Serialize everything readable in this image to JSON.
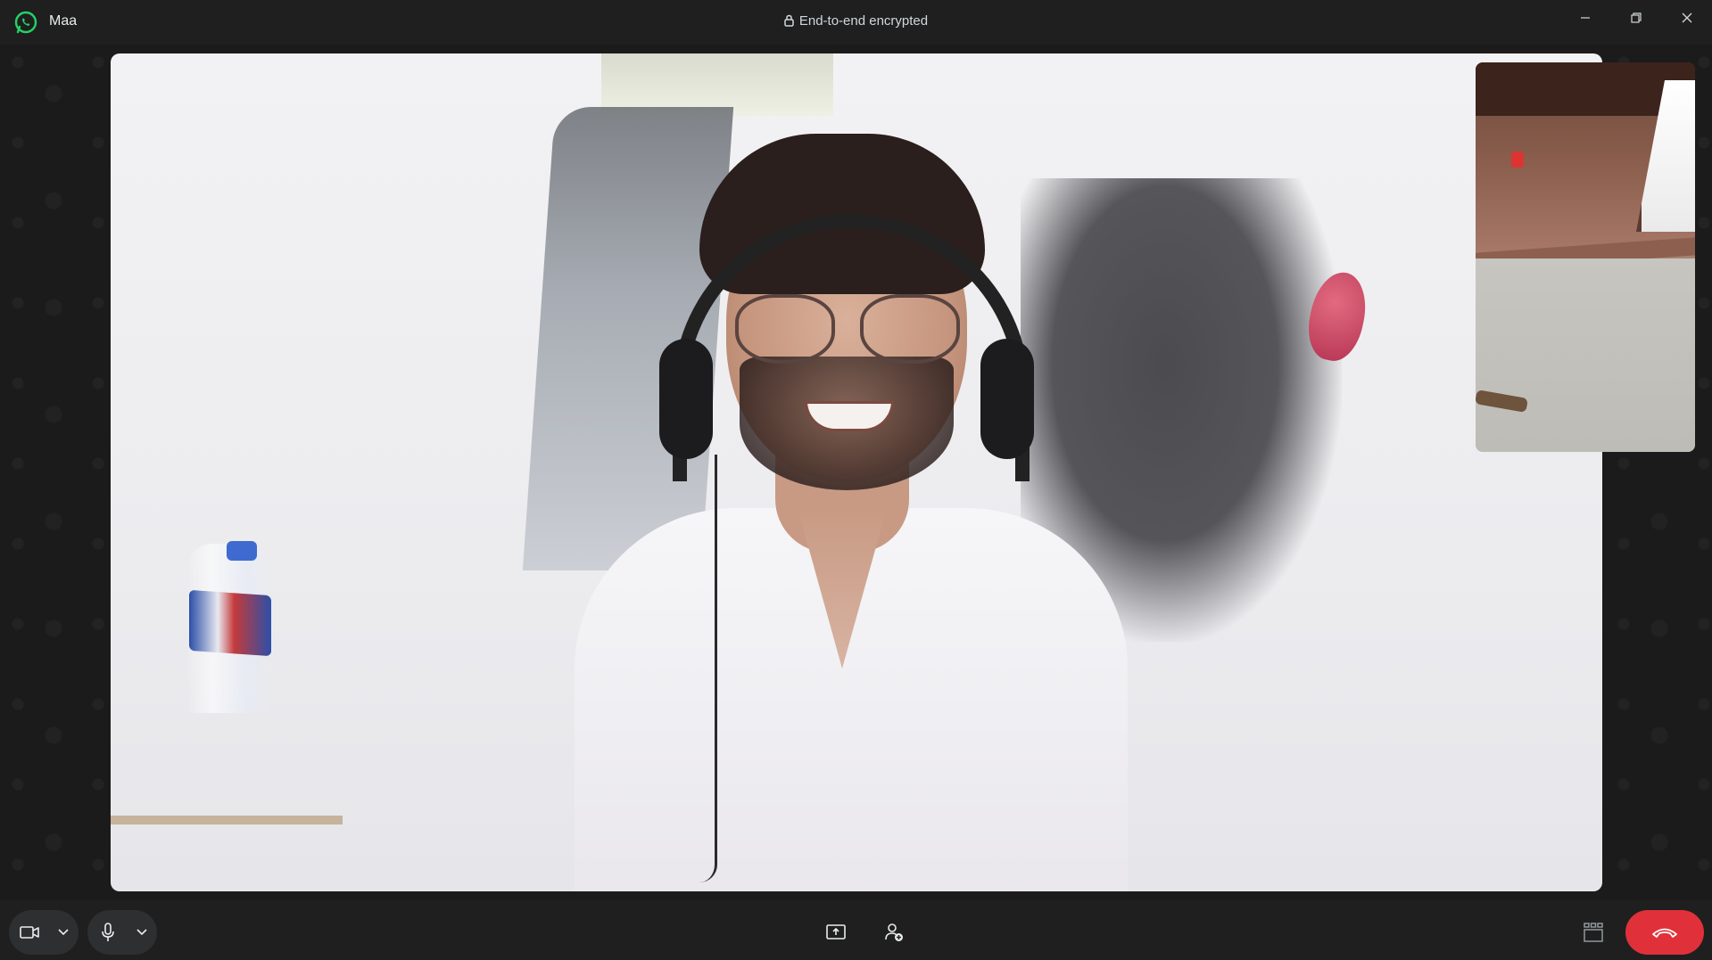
{
  "window": {
    "app_icon": "whatsapp-logo",
    "contact_name": "Maa",
    "encryption_label": "End-to-end encrypted",
    "lock_icon": "lock-icon"
  },
  "window_controls": {
    "minimize_icon": "minimize-icon",
    "maximize_icon": "restore-icon",
    "close_icon": "close-icon"
  },
  "call": {
    "remote_video_icon": "remote-video-feed",
    "self_preview_icon": "self-video-preview"
  },
  "controls": {
    "camera_icon": "video-camera-icon",
    "camera_options_icon": "chevron-down-icon",
    "mic_icon": "microphone-icon",
    "mic_options_icon": "chevron-down-icon",
    "share_screen_icon": "share-screen-icon",
    "add_participant_icon": "add-person-icon",
    "layout_icon": "layout-grid-icon",
    "end_call_icon": "end-call-icon"
  },
  "colors": {
    "background": "#1f1f1f",
    "whatsapp_green": "#25d366",
    "end_call_red": "#e0313a",
    "control_bg": "#2e2f31"
  }
}
